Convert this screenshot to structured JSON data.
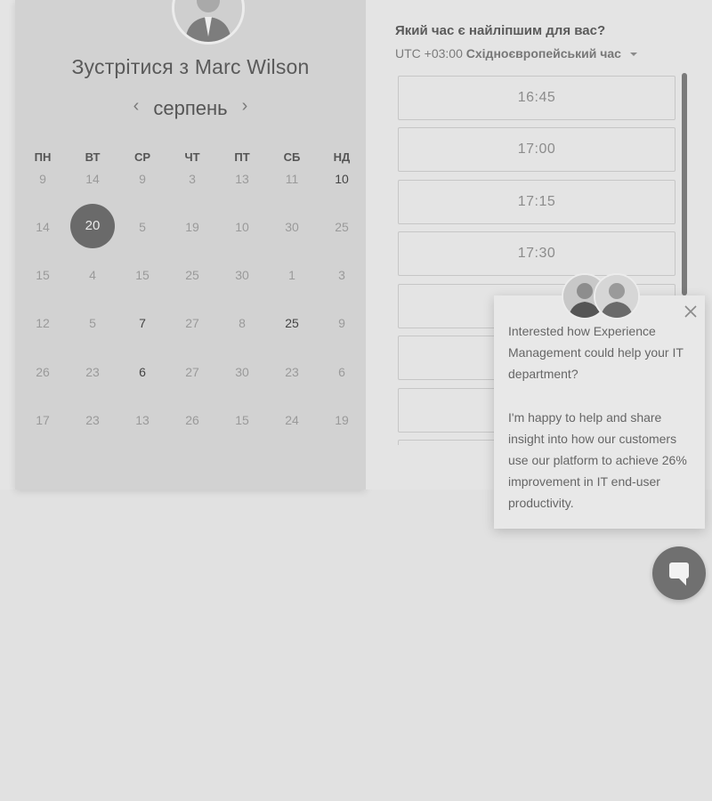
{
  "booking": {
    "meet_title_prefix": "Зустрітися з",
    "host_name": "Marc Wilson",
    "month": "серпень",
    "weekdays": [
      "ПН",
      "ВТ",
      "СР",
      "ЧТ",
      "ПТ",
      "СБ",
      "НД"
    ],
    "weeks": [
      [
        "9",
        "14",
        "9",
        "3",
        "13",
        "11",
        "10"
      ],
      [
        "14",
        "20",
        "5",
        "19",
        "10",
        "30",
        "25"
      ],
      [
        "15",
        "4",
        "15",
        "25",
        "30",
        "1",
        "3"
      ],
      [
        "12",
        "5",
        "7",
        "27",
        "8",
        "25",
        "9"
      ],
      [
        "26",
        "23",
        "6",
        "27",
        "30",
        "23",
        "6"
      ],
      [
        "17",
        "23",
        "13",
        "26",
        "15",
        "24",
        "19"
      ]
    ],
    "selected_day": "20"
  },
  "time_picker": {
    "question": "Який час є найліпшим для вас?",
    "timezone_offset": "UTC +03:00",
    "timezone_name": "Східноєвропейський час",
    "slots": [
      "16:45",
      "17:00",
      "17:15",
      "17:30",
      "",
      "",
      ""
    ]
  },
  "chat": {
    "message_1": "Interested how Experience Management could help your IT department?",
    "message_2": "I'm happy to help and share insight into how our customers use our platform to achieve 26% improvement in IT end-user productivity."
  },
  "icons": {
    "prev": "chevron-left-icon",
    "next": "chevron-right-icon",
    "close": "close-icon",
    "chat": "chat-bubble-icon",
    "dropdown": "caret-down-icon"
  }
}
